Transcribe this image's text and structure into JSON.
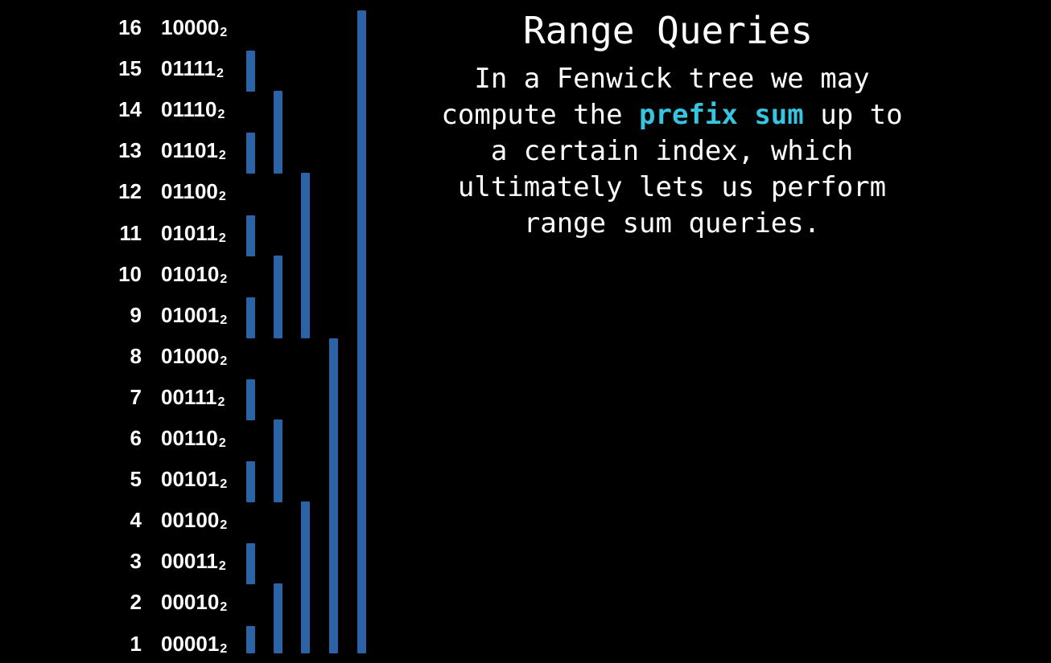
{
  "title": "Range Queries",
  "description": {
    "line1": "In a Fenwick tree we may",
    "line2_before": "compute the ",
    "line2_highlight": "prefix sum",
    "line2_after": " up to",
    "line3": "a certain index, which",
    "line4": "ultimately lets us perform",
    "line5": "range sum queries."
  },
  "colors": {
    "background": "#000000",
    "text": "#ffffff",
    "bar": "#2b63a6",
    "highlight": "#35c5e0"
  },
  "binary_subscript": "2",
  "rows": [
    {
      "index": "16",
      "binary": "10000"
    },
    {
      "index": "15",
      "binary": "01111"
    },
    {
      "index": "14",
      "binary": "01110"
    },
    {
      "index": "13",
      "binary": "01101"
    },
    {
      "index": "12",
      "binary": "01100"
    },
    {
      "index": "11",
      "binary": "01011"
    },
    {
      "index": "10",
      "binary": "01010"
    },
    {
      "index": "9",
      "binary": "01001"
    },
    {
      "index": "8",
      "binary": "01000"
    },
    {
      "index": "7",
      "binary": "00111"
    },
    {
      "index": "6",
      "binary": "00110"
    },
    {
      "index": "5",
      "binary": "00101"
    },
    {
      "index": "4",
      "binary": "00100"
    },
    {
      "index": "3",
      "binary": "00011"
    },
    {
      "index": "2",
      "binary": "00010"
    },
    {
      "index": "1",
      "binary": "00001"
    }
  ]
}
